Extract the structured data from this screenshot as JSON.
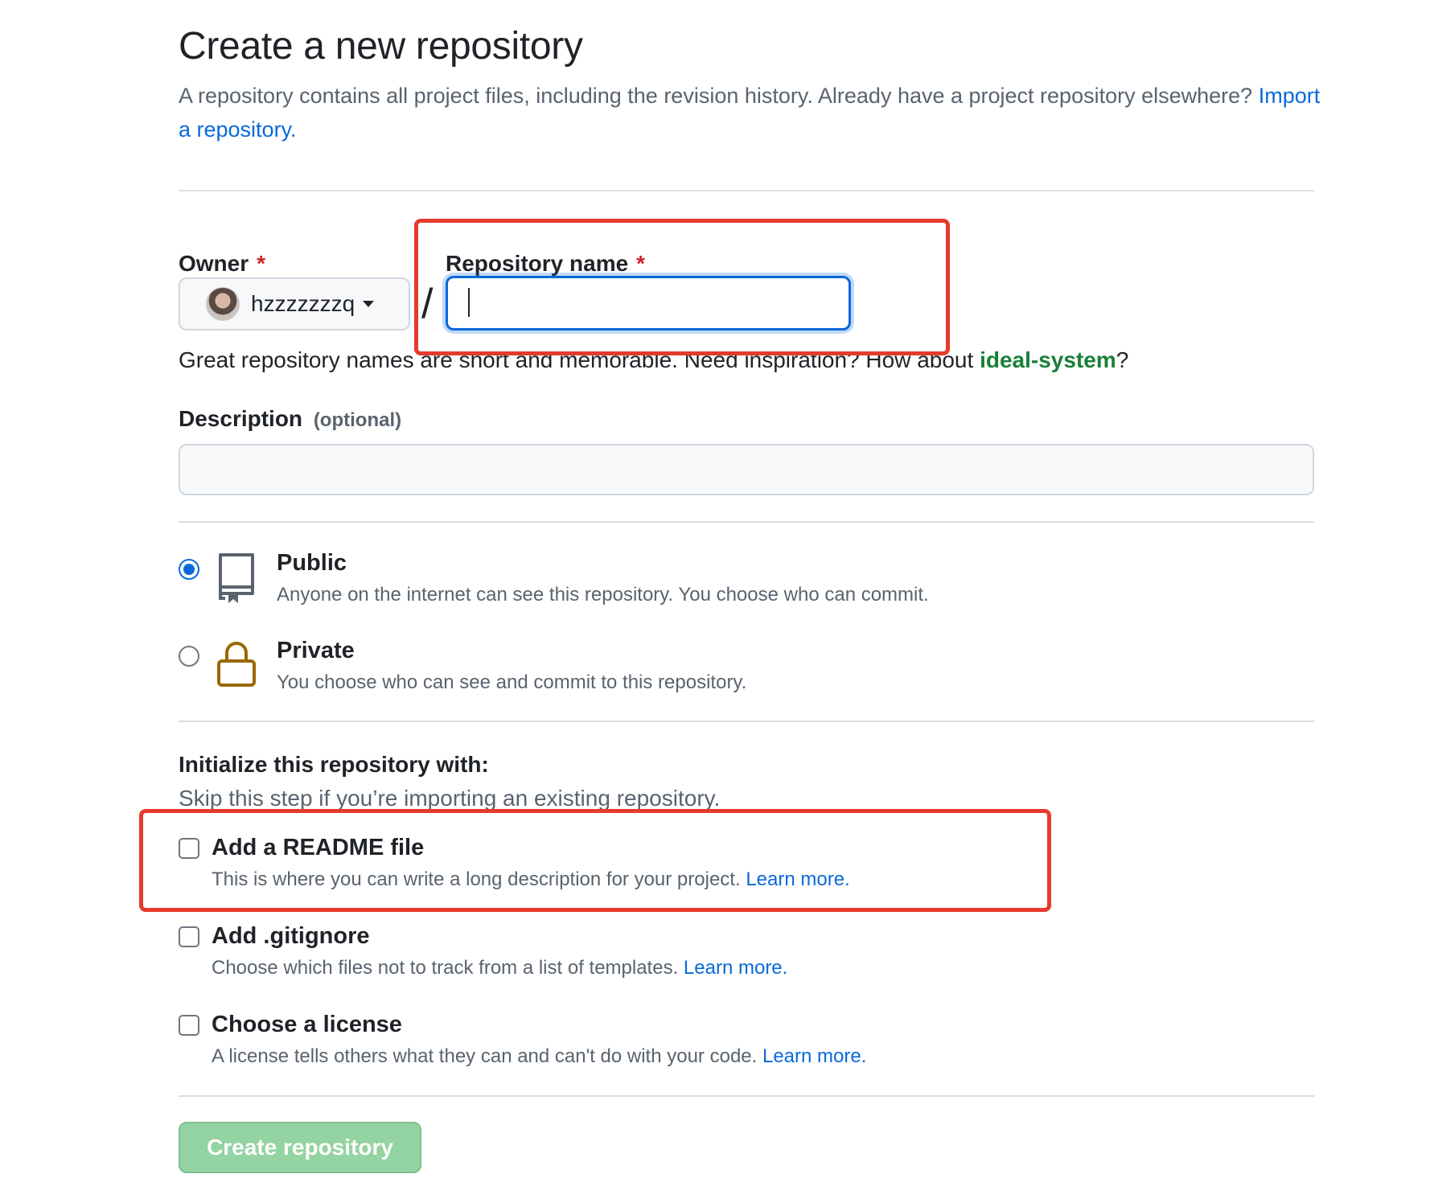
{
  "header": {
    "title": "Create a new repository",
    "intro_text": "A repository contains all project files, including the revision history. Already have a project repository elsewhere?",
    "import_link": "Import a repository."
  },
  "owner": {
    "label": "Owner",
    "required_mark": "*",
    "value": "hzzzzzzzq"
  },
  "repo_name": {
    "label": "Repository name",
    "required_mark": "*",
    "value": "",
    "separator": "/"
  },
  "name_hint": {
    "prefix": "Great repository names are short and memorable. Need inspiration? How about",
    "suggestion": "ideal-system",
    "suffix": "?"
  },
  "description": {
    "label": "Description",
    "optional": "(optional)",
    "value": ""
  },
  "visibility": {
    "selected": "public",
    "public": {
      "title": "Public",
      "desc": "Anyone on the internet can see this repository. You choose who can commit.",
      "icon": "repo-icon"
    },
    "private": {
      "title": "Private",
      "desc": "You choose who can see and commit to this repository.",
      "icon": "lock-icon"
    }
  },
  "initialize": {
    "title": "Initialize this repository with:",
    "subtitle": "Skip this step if you’re importing an existing repository.",
    "readme": {
      "title": "Add a README file",
      "desc": "This is where you can write a long description for your project.",
      "link": "Learn more.",
      "checked": false
    },
    "gitignore": {
      "title": "Add .gitignore",
      "desc": "Choose which files not to track from a list of templates.",
      "link": "Learn more.",
      "checked": false
    },
    "license": {
      "title": "Choose a license",
      "desc": "A license tells others what they can and can't do with your code.",
      "link": "Learn more.",
      "checked": false
    }
  },
  "actions": {
    "create_label": "Create repository"
  },
  "colors": {
    "link": "#0969da",
    "suggestion": "#1a7f37",
    "highlight": "#e53b2e",
    "create_button": "#94d3a2",
    "lock_icon": "#9a6700"
  }
}
